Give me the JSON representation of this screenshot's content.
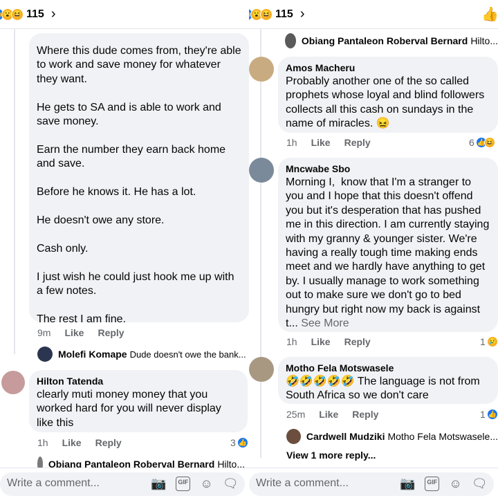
{
  "left": {
    "header": {
      "count": "115"
    },
    "comments": [
      {
        "text": "Where this dude comes from, they're able to work and save money for whatever they want.\n\nHe gets to SA and is able to work and save money.\n\nEarn the number they earn back home and save.\n\nBefore he knows it. He has a lot.\n\nHe doesn't owe any store.\n\nCash only.\n\nI just wish he could just hook me up with a few notes.\n\nThe rest I am fine.",
        "time": "9m",
        "like": "Like",
        "reply": "Reply"
      },
      {
        "author": "Hilton Tatenda",
        "text": "clearly muti money money that you worked hard for you will never display like this",
        "time": "1h",
        "like": "Like",
        "reply": "Reply",
        "reactions": "3"
      }
    ],
    "replies": [
      {
        "author": "Molefi Komape",
        "text": "Dude doesn't owe the bank..."
      },
      {
        "author": "Obiang Pantaleon Roberval Bernard",
        "text": "Hilto..."
      }
    ],
    "composer": {
      "placeholder": "Write a comment..."
    }
  },
  "right": {
    "header": {
      "count": "115"
    },
    "top_reply": {
      "author": "Obiang Pantaleon Roberval Bernard",
      "text": "Hilto..."
    },
    "comments": [
      {
        "author": "Amos Macheru",
        "text": "Probably another one of the so called prophets whose loyal and blind followers collects all this cash on sundays in the name of miracles.",
        "emoji": "😖",
        "time": "1h",
        "like": "Like",
        "reply": "Reply",
        "reactions": "6"
      },
      {
        "author": "Mncwabe Sbo",
        "text": "Morning I,  know that I'm a stranger to you and I hope that this doesn't offend you but it's desperation that has pushed me in this direction. I am currently staying with my granny & younger sister. We're having a really tough time making ends meet and we hardly have anything to get by. I usually manage to work something out to make sure we don't go to bed hungry but right now my back is against t...",
        "see_more": "See More",
        "time": "1h",
        "like": "Like",
        "reply": "Reply",
        "reactions": "1"
      },
      {
        "author": "Motho Fela Motswasele",
        "emojis": "🤣🤣🤣🤣🤣",
        "text": " The language is not from South Africa so we don't care",
        "time": "25m",
        "like": "Like",
        "reply": "Reply",
        "reactions": "1"
      }
    ],
    "bottom_reply": {
      "author": "Cardwell Mudziki",
      "text": "Motho Fela Motswasele..."
    },
    "view_more": "View 1 more reply...",
    "composer": {
      "placeholder": "Write a comment..."
    }
  },
  "colors": {
    "like_blue": "#1877f2",
    "bubble_bg": "#f0f2f5",
    "muted": "#65676b"
  },
  "icons": [
    "like-icon",
    "wow-icon",
    "haha-icon",
    "chevron-right-icon",
    "thumbs-up-icon",
    "camera-icon",
    "gif-icon",
    "smiley-icon",
    "sticker-icon"
  ]
}
